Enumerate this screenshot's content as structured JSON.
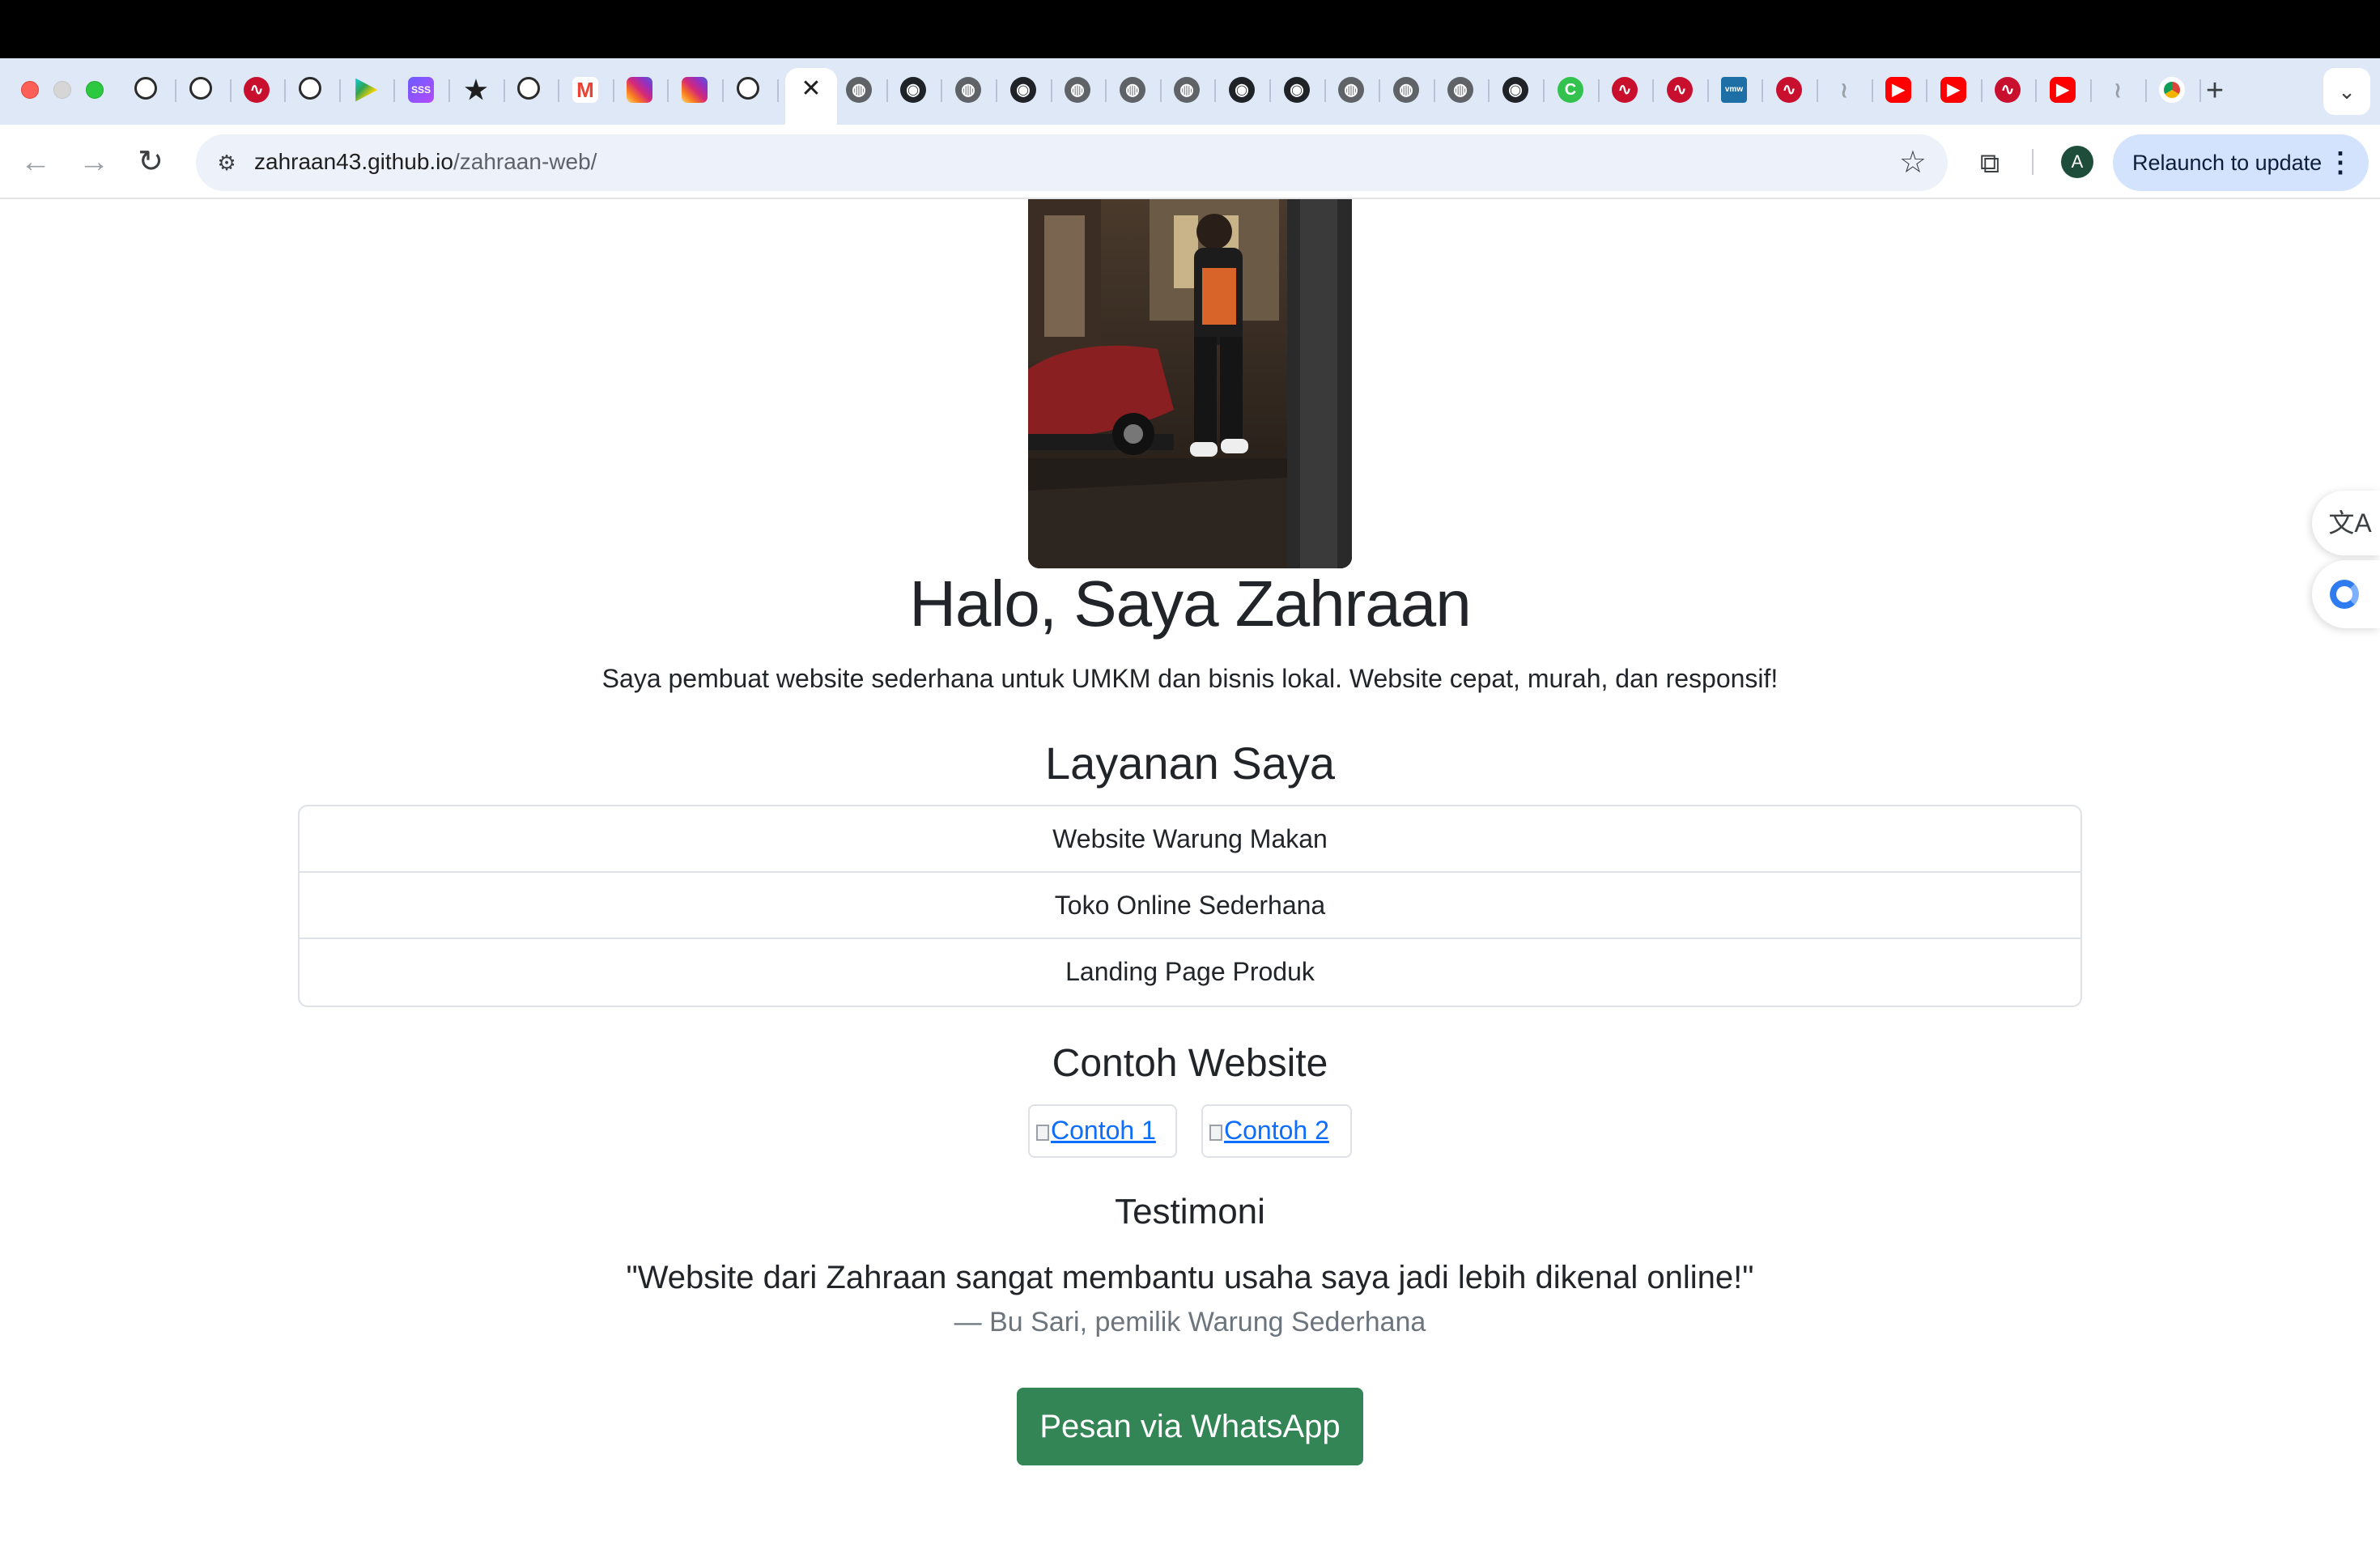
{
  "browser": {
    "tabs": [
      {
        "icon": "openai-icon"
      },
      {
        "icon": "openai-icon"
      },
      {
        "icon": "red-pulse-icon"
      },
      {
        "icon": "openai-icon"
      },
      {
        "icon": "google-play-icon"
      },
      {
        "icon": "sss-icon",
        "label": "SSS"
      },
      {
        "icon": "star-pin-icon"
      },
      {
        "icon": "openai-icon"
      },
      {
        "icon": "gmail-icon",
        "label": "M"
      },
      {
        "icon": "instagram-icon"
      },
      {
        "icon": "instagram-icon"
      },
      {
        "icon": "openai-icon"
      },
      {
        "icon": "close-icon",
        "active": true
      },
      {
        "icon": "globe-icon"
      },
      {
        "icon": "github-icon"
      },
      {
        "icon": "globe-icon"
      },
      {
        "icon": "github-icon"
      },
      {
        "icon": "globe-icon"
      },
      {
        "icon": "globe-icon"
      },
      {
        "icon": "globe-icon"
      },
      {
        "icon": "github-icon"
      },
      {
        "icon": "github-icon"
      },
      {
        "icon": "globe-icon"
      },
      {
        "icon": "globe-icon"
      },
      {
        "icon": "globe-icon"
      },
      {
        "icon": "github-icon"
      },
      {
        "icon": "green-c-icon",
        "label": "C"
      },
      {
        "icon": "red-pulse-icon"
      },
      {
        "icon": "red-pulse-icon"
      },
      {
        "icon": "vmware-icon",
        "label": "vmw"
      },
      {
        "icon": "red-pulse-icon"
      },
      {
        "icon": "feather-icon"
      },
      {
        "icon": "youtube-icon"
      },
      {
        "icon": "youtube-icon"
      },
      {
        "icon": "red-pulse-icon"
      },
      {
        "icon": "youtube-icon"
      },
      {
        "icon": "feather-icon"
      },
      {
        "icon": "chrome-icon"
      }
    ],
    "new_tab_label": "+",
    "url_host": "zahraan43.github.io",
    "url_path": "/zahraan-web/",
    "avatar_letter": "A",
    "relaunch_label": "Relaunch to update",
    "colors": {
      "tabstrip": "#dfe8f7",
      "omnibox": "#edf1fa",
      "relaunch": "#d3e3fd"
    }
  },
  "page": {
    "hero": {
      "title": "Halo, Saya Zahraan",
      "subtitle": "Saya pembuat website sederhana untuk UMKM dan bisnis lokal. Website cepat, murah, dan responsif!"
    },
    "services": {
      "title": "Layanan Saya",
      "items": [
        "Website Warung Makan",
        "Toko Online Sederhana",
        "Landing Page Produk"
      ]
    },
    "examples": {
      "title": "Contoh Website",
      "items": [
        {
          "alt": "Contoh 1"
        },
        {
          "alt": "Contoh 2"
        }
      ]
    },
    "testimoni": {
      "title": "Testimoni",
      "quote": "\"Website dari Zahraan sangat membantu usaha saya jadi lebih dikenal online!\"",
      "author": "— Bu Sari, pemilik Warung Sederhana"
    },
    "cta": {
      "label": "Pesan via WhatsApp",
      "color": "#348555"
    },
    "side_widgets": [
      {
        "icon": "translate-icon"
      },
      {
        "icon": "assistant-icon"
      }
    ]
  }
}
